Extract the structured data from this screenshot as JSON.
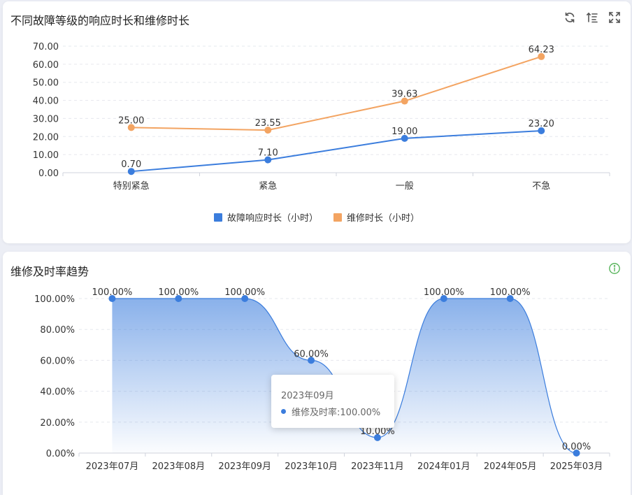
{
  "colors": {
    "response": "#3b7ddd",
    "repair": "#f3a462",
    "rate": "#3b7ddd",
    "info": "#4caf50"
  },
  "card1": {
    "title": "不同故障等级的响应时长和维修时长",
    "tools": [
      "refresh-icon",
      "sort-icon",
      "fullscreen-icon"
    ]
  },
  "card2": {
    "title": "维修及时率趋势",
    "info_icon": "info-icon",
    "tooltip": {
      "title": "2023年09月",
      "series": "维修及时率",
      "value": "100.00%"
    }
  },
  "chart_data": [
    {
      "type": "line",
      "title": "不同故障等级的响应时长和维修时长",
      "categories": [
        "特别紧急",
        "紧急",
        "一般",
        "不急"
      ],
      "series": [
        {
          "name": "故障响应时长（小时）",
          "values": [
            0.7,
            7.1,
            19.0,
            23.2
          ],
          "labels": [
            "0.70",
            "7.10",
            "19.00",
            "23.20"
          ]
        },
        {
          "name": "维修时长（小时）",
          "values": [
            25.0,
            23.55,
            39.63,
            64.23
          ],
          "labels": [
            "25.00",
            "23.55",
            "39.63",
            "64.23"
          ]
        }
      ],
      "yticks": [
        "0.00",
        "10.00",
        "20.00",
        "30.00",
        "40.00",
        "50.00",
        "60.00",
        "70.00"
      ],
      "ylim": [
        0,
        70
      ],
      "grid": true,
      "legend_position": "bottom"
    },
    {
      "type": "area",
      "title": "维修及时率趋势",
      "categories": [
        "2023年07月",
        "2023年08月",
        "2023年09月",
        "2023年10月",
        "2023年11月",
        "2024年01月",
        "2024年05月",
        "2025年03月"
      ],
      "series": [
        {
          "name": "维修及时率",
          "values": [
            100,
            100,
            100,
            60,
            10,
            100,
            100,
            0
          ],
          "labels": [
            "100.00%",
            "100.00%",
            "100.00%",
            "60.00%",
            "10.00%",
            "100.00%",
            "100.00%",
            "0.00%"
          ]
        }
      ],
      "yticks": [
        "0.00%",
        "20.00%",
        "40.00%",
        "60.00%",
        "80.00%",
        "100.00%"
      ],
      "ylim": [
        0,
        100
      ],
      "smooth": true,
      "grid": true
    }
  ]
}
